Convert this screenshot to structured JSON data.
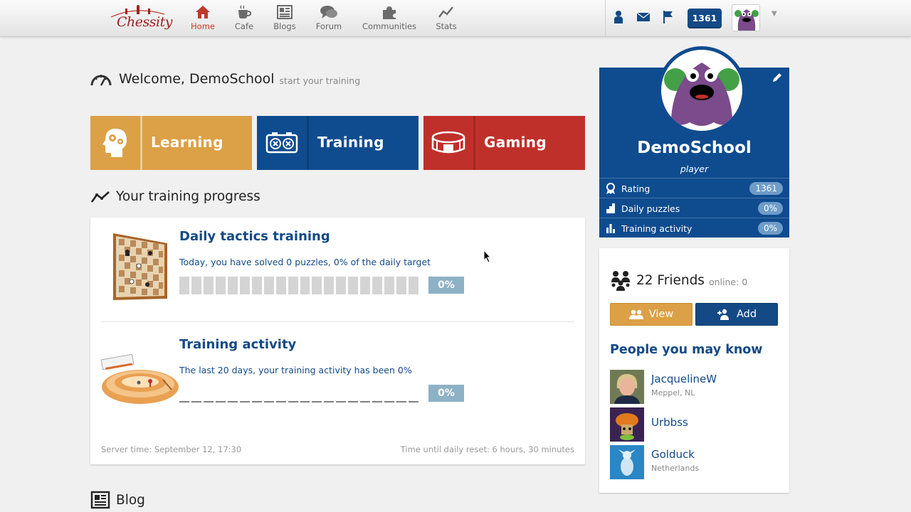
{
  "brand": {
    "name": "Chessity"
  },
  "nav": [
    {
      "label": "Home",
      "icon": "home-icon",
      "active": true
    },
    {
      "label": "Cafe",
      "icon": "cafe-cup-icon"
    },
    {
      "label": "Blogs",
      "icon": "newspaper-icon"
    },
    {
      "label": "Forum",
      "icon": "speech-bubbles-icon"
    },
    {
      "label": "Communities",
      "icon": "puzzle-piece-icon"
    },
    {
      "label": "Stats",
      "icon": "line-chart-icon"
    }
  ],
  "topbar": {
    "rating": "1361",
    "icons": [
      "person-icon",
      "mail-icon",
      "flag-icon"
    ]
  },
  "welcome": {
    "title": "Welcome, DemoSchool",
    "subtitle": "start your training"
  },
  "tiles": [
    {
      "label": "Learning",
      "color": "#dca046"
    },
    {
      "label": "Training",
      "color": "#0f4c8f"
    },
    {
      "label": "Gaming",
      "color": "#c0302a"
    }
  ],
  "progress": {
    "section_title": "Your training progress",
    "daily": {
      "title": "Daily tactics training",
      "desc": "Today, you have solved 0 puzzles, 0% of the daily target",
      "percent": "0%",
      "fraction": 0
    },
    "activity": {
      "title": "Training activity",
      "desc": "The last 20 days, your training activity has been 0%",
      "percent": "0%",
      "fraction": 0
    },
    "server_time": "Server time: September 12, 17:30",
    "reset_time": "Time until daily reset: 6 hours, 30 minutes"
  },
  "profile": {
    "name": "DemoSchool",
    "role": "player",
    "stats": [
      {
        "label": "Rating",
        "value": "1361",
        "icon": "rating-medal-icon"
      },
      {
        "label": "Daily puzzles",
        "value": "0%",
        "icon": "bar-steps-icon"
      },
      {
        "label": "Training activity",
        "value": "0%",
        "icon": "bar-chart-icon"
      }
    ]
  },
  "friends": {
    "count_label": "22 Friends",
    "online_label": "online: 0",
    "view_label": "View",
    "add_label": "Add",
    "pymk_title": "People you may know",
    "people": [
      {
        "name": "JacquelineW",
        "location": "Meppel, NL"
      },
      {
        "name": "Urbbss",
        "location": ""
      },
      {
        "name": "Golduck",
        "location": "Netherlands"
      }
    ]
  },
  "blog": {
    "section_title": "Blog"
  },
  "colors": {
    "brand_blue": "#134a86",
    "orange": "#dca046",
    "red": "#c0302a"
  }
}
